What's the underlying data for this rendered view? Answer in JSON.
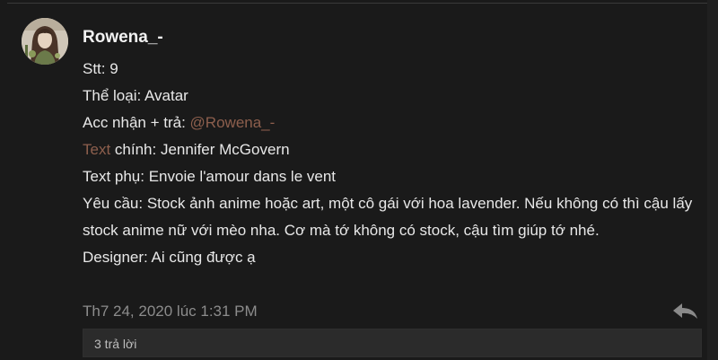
{
  "post": {
    "username": "Rowena_-",
    "lines": {
      "stt_label": "Stt: ",
      "stt_value": "9",
      "category_label": "Thể loại: ",
      "category_value": "Avatar",
      "acc_label": "Acc nhận + trả: ",
      "acc_mention": "@Rowena_-",
      "text_main_link": "Text",
      "text_main_rest": " chính: Jennifer McGovern",
      "text_sub": "Text phụ: Envoie l'amour dans le vent",
      "request": "Yêu cầu: Stock ảnh anime hoặc art, một cô gái với hoa lavender. Nếu không có thì cậu lấy stock anime nữ với mèo nha. Cơ mà tớ không có stock, cậu tìm giúp tớ nhé.",
      "designer": "Designer: Ai cũng được ạ"
    },
    "timestamp": "Th7 24, 2020 lúc 1:31 PM",
    "replies_label": "3 trả lời"
  },
  "icons": {
    "reply": "reply-arrow-icon",
    "avatar": "user-avatar-image"
  },
  "colors": {
    "background": "#1a1a1a",
    "text": "#e8e8e8",
    "accent": "#8d5f4d",
    "muted": "#8c8c8c",
    "replies_bar": "#2b2b2b"
  }
}
